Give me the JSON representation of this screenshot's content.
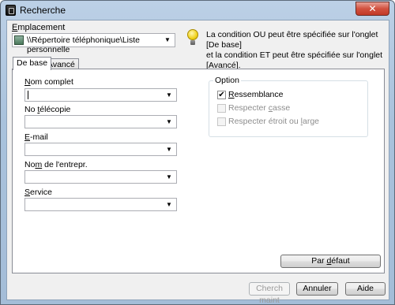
{
  "window": {
    "title": "Recherche",
    "close_symbol": "✕"
  },
  "location": {
    "label_underlined": "E",
    "label_rest": "mplacement",
    "value": "\\\\Répertoire téléphonique\\Liste personnelle"
  },
  "info": {
    "line1": "La condition OU peut être spécifiée sur l'onglet [De base]",
    "line2": "et la condition ET peut être spécifiée sur l'onglet [Avancé]."
  },
  "tabs": [
    {
      "label": "De base",
      "active": true
    },
    {
      "label": "Avancé",
      "active": false
    }
  ],
  "fields": [
    {
      "pre": "",
      "u": "N",
      "post": "om complet",
      "value": ""
    },
    {
      "pre": "No ",
      "u": "t",
      "post": "élécopie",
      "value": ""
    },
    {
      "pre": "",
      "u": "E",
      "post": "-mail",
      "value": ""
    },
    {
      "pre": "No",
      "u": "m",
      "post": " de l'entrepr.",
      "value": ""
    },
    {
      "pre": "",
      "u": "S",
      "post": "ervice",
      "value": ""
    }
  ],
  "option": {
    "title": "Option",
    "items": [
      {
        "pre": "",
        "u": "R",
        "post": "essemblance",
        "checked": true,
        "enabled": true
      },
      {
        "pre": "Respecter ",
        "u": "c",
        "post": "asse",
        "checked": false,
        "enabled": false
      },
      {
        "pre": "Respecter étroit ou ",
        "u": "l",
        "post": "arge",
        "checked": false,
        "enabled": false
      }
    ]
  },
  "buttons": {
    "default": {
      "pre": "Par ",
      "u": "d",
      "post": "éfaut"
    },
    "search": "Cherch maint",
    "cancel": "Annuler",
    "help": "Aide"
  },
  "colors": {
    "accent_titlebar": "#a9c2dc",
    "close_button": "#c23a27"
  },
  "icons": [
    "app-icon",
    "phonebook-icon",
    "lightbulb-icon",
    "dropdown-arrow-icon",
    "checkmark-icon"
  ]
}
